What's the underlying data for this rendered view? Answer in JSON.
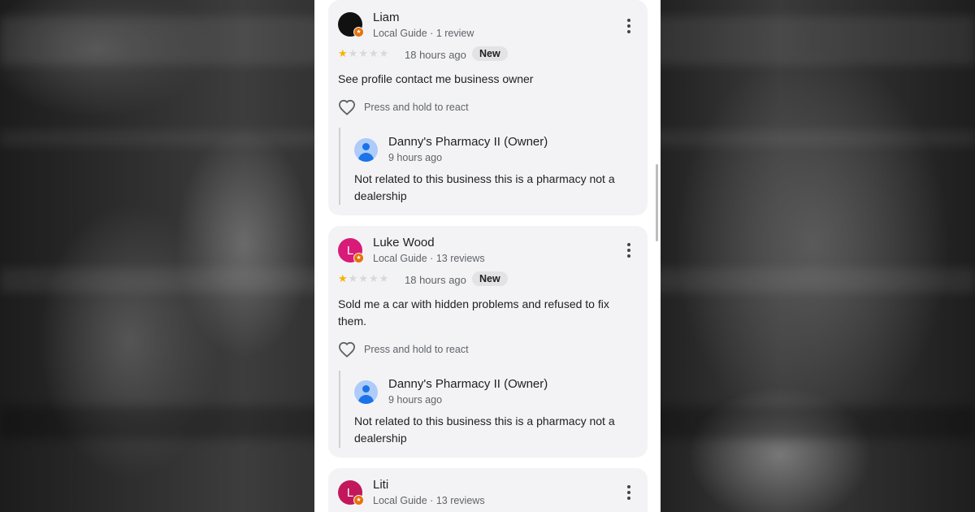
{
  "reviews": [
    {
      "name": "Liam",
      "meta": "Local Guide · 1 review",
      "avatar_letter": "",
      "avatar_color": "#111111",
      "rating": 1,
      "time": "18 hours ago",
      "badge": "New",
      "text": "See profile contact me business owner",
      "react_label": "Press and hold to react",
      "reply": {
        "owner": "Danny's Pharmacy II (Owner)",
        "time": "9 hours ago",
        "text": "Not related to this business this is a pharmacy not a dealership"
      }
    },
    {
      "name": "Luke Wood",
      "meta": "Local Guide · 13 reviews",
      "avatar_letter": "L",
      "avatar_color": "#d81b78",
      "rating": 1,
      "time": "18 hours ago",
      "badge": "New",
      "text": "Sold me a car with hidden problems and refused to fix them.",
      "react_label": "Press and hold to react",
      "reply": {
        "owner": "Danny's Pharmacy II (Owner)",
        "time": "9 hours ago",
        "text": "Not related to this business this is a pharmacy not a dealership"
      }
    },
    {
      "name": "Liti",
      "meta": "Local Guide · 13 reviews",
      "avatar_letter": "L",
      "avatar_color": "#c2185b"
    }
  ],
  "colors": {
    "star_filled": "#f4b400",
    "star_empty": "#d8d8d8",
    "owner_blue": "#1a73e8"
  },
  "icons": {
    "more": "kebab-icon",
    "react": "heart-icon",
    "guide": "local-guide-badge-icon",
    "owner": "profile-icon"
  }
}
